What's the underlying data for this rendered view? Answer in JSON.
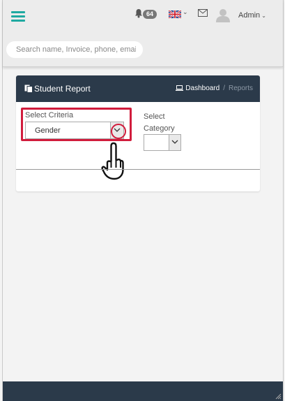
{
  "header": {
    "notification_count": "64",
    "user_name": "Admin",
    "icons": [
      "menu-icon",
      "bell-icon",
      "uk-flag-icon",
      "envelope-icon",
      "user-avatar-icon"
    ]
  },
  "search": {
    "placeholder": "Search name, Invoice, phone, email"
  },
  "panel": {
    "title": "Student Report",
    "breadcrumb": {
      "dashboard": "Dashboard",
      "separator": "/",
      "current": "Reports"
    },
    "criteria": {
      "label": "Select Criteria",
      "value": "Gender"
    },
    "category": {
      "label_line1": "Select",
      "label_line2": "Category",
      "value": ""
    }
  },
  "colors": {
    "accent": "#1fa9a1",
    "panel_header": "#2b3a4a",
    "highlight": "#d11c3c",
    "badge": "#777777"
  }
}
